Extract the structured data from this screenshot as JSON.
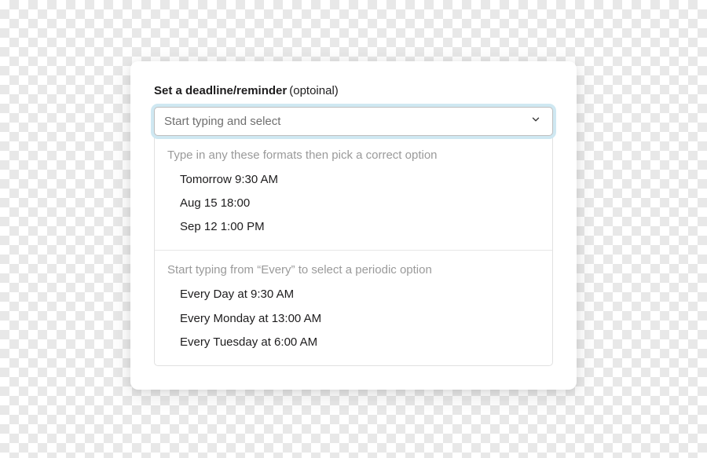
{
  "label": {
    "main": "Set a deadline/reminder",
    "optional": "(optoinal)"
  },
  "select": {
    "placeholder": "Start typing and select"
  },
  "sections": [
    {
      "header": "Type in any these formats then pick a correct option",
      "options": [
        "Tomorrow 9:30 AM",
        "Aug 15 18:00",
        "Sep 12 1:00 PM"
      ]
    },
    {
      "header": "Start typing from “Every” to select a periodic option",
      "options": [
        "Every Day at 9:30 AM",
        "Every Monday at 13:00 AM",
        "Every Tuesday at 6:00 AM"
      ]
    }
  ]
}
